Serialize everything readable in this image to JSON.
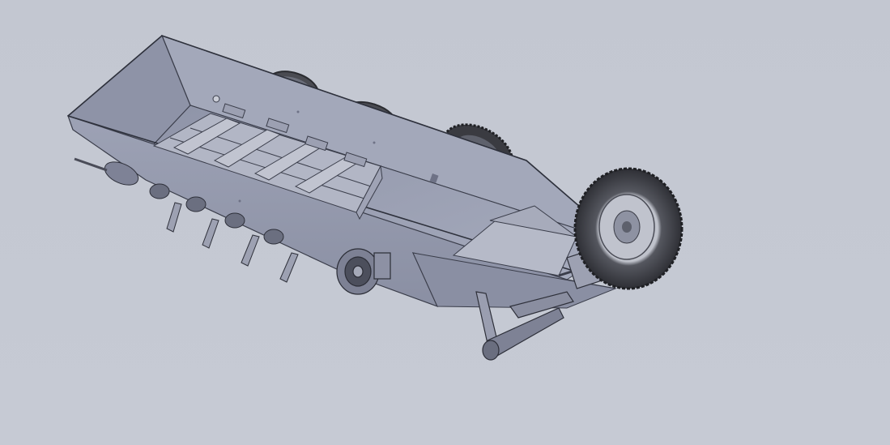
{
  "viewport": {
    "background_color": "#c4c8d2",
    "model": "manure-spreader-trailer",
    "colors": {
      "body_light": "#9ea3b6",
      "body_mid": "#8a8fa4",
      "body_dark": "#6e7389",
      "edge": "#3a3d4a",
      "tire": "#3b3c42",
      "rim": "#b9bcc6"
    }
  }
}
